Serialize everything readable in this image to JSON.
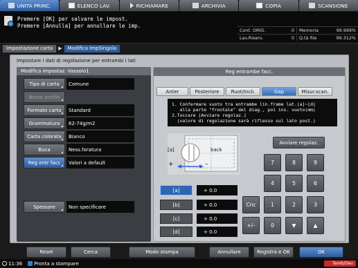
{
  "tabs": [
    {
      "label": "UNITA PRINC.",
      "icon": "home-icon",
      "active": true
    },
    {
      "label": "ELENCO LAV.",
      "icon": "job-list-icon",
      "active": false
    },
    {
      "label": "RICHIAMARE",
      "icon": "recall-icon",
      "active": false
    },
    {
      "label": "ARCHIVIA",
      "icon": "archive-icon",
      "active": false
    },
    {
      "label": "COPIA",
      "icon": "copy-icon",
      "active": false
    },
    {
      "label": "SCANSIONE",
      "icon": "scan-icon",
      "active": false
    }
  ],
  "message": {
    "line1": "Premere [OK] per salvare le impost.",
    "line2": "Premere [Annulla] per annullare le imp."
  },
  "counters": {
    "cont_orig_label": "Cont. ORIG.",
    "cont_orig_value": "0",
    "memoria_label": "Memoria",
    "memoria_value": "99.999%",
    "lav_riserv_label": "Lav.Riserv.",
    "lav_riserv_value": "0",
    "qta_file_label": "Q.tà file",
    "qta_file_value": "99.312%"
  },
  "breadcrumb": {
    "item1": "Impostazione carta",
    "item2": "Modifica ImpSingola"
  },
  "panel": {
    "instruction": "Impostare i dati di regolazione per entrambi i lati",
    "left_header": "Modifica impostaz.  Vassoio1",
    "right_header": "Reg entrambe facc."
  },
  "settings": [
    {
      "label": "Tipo di carta",
      "value": "Comune",
      "state": "normal"
    },
    {
      "label": "Nome profilo",
      "value": "",
      "state": "disabled"
    },
    {
      "label": "Formato carta",
      "value": "Standard",
      "state": "normal"
    },
    {
      "label": "Grammatura",
      "value": "62-74g/m2",
      "state": "normal"
    },
    {
      "label": "Carta colorata",
      "value": "Bianco",
      "state": "normal"
    },
    {
      "label": "Buca",
      "value": "Ness.foratura",
      "state": "normal"
    },
    {
      "label": "Reg entr facc",
      "value": "Valori a default",
      "state": "selected"
    },
    {
      "label": "Spessore",
      "value": "Non specificare",
      "state": "normal"
    }
  ],
  "sub_tabs": [
    "Anter",
    "Posteriore",
    "Ruot/Incli.",
    "Gap",
    "Misur.scan."
  ],
  "active_sub_tab": "Gap",
  "instructions": {
    "l1": "1. Confermare vuoto tra entrambe lin.frame lat.[a]~[d]",
    "l2": "   alla parte \"frontale\" del diag., poi ins. vuoto(mm)",
    "l3": "2.Toccare [Avviare regolaz.]",
    "l4": "  (valore di regolazione sarà riflesso sul lato post.)"
  },
  "diagram": {
    "label_a": "[a]",
    "label_back": "back",
    "plus": "+",
    "minus": "–"
  },
  "avvia_label": "Avviare regolaz.",
  "gaps": [
    {
      "label": "[a]",
      "value": "+ 0.0",
      "active": true
    },
    {
      "label": "[b]",
      "value": "+ 0.0",
      "active": false
    },
    {
      "label": "[c]",
      "value": "+ 0.0",
      "active": false
    },
    {
      "label": "[d]",
      "value": "+ 0.0",
      "active": false
    }
  ],
  "keypad": {
    "k7": "7",
    "k8": "8",
    "k9": "9",
    "k4": "4",
    "k5": "5",
    "k6": "6",
    "k1": "1",
    "k2": "2",
    "k3": "3",
    "k0": "0",
    "canc": "Cnc",
    "plusminus": "+/–"
  },
  "bottom": {
    "reset": "Reset",
    "cerca": "Cerca",
    "modo_stampa": "Modo stampa",
    "annullare": "Annullare",
    "registra_ok": "Registra e OK",
    "ok": "OK"
  },
  "status": {
    "time": "11:36",
    "text": "Pronta a stampare",
    "badge": "Tamb/Dev"
  },
  "colors": {
    "accent": "#2e5c9c",
    "badge": "#c72a2a"
  }
}
